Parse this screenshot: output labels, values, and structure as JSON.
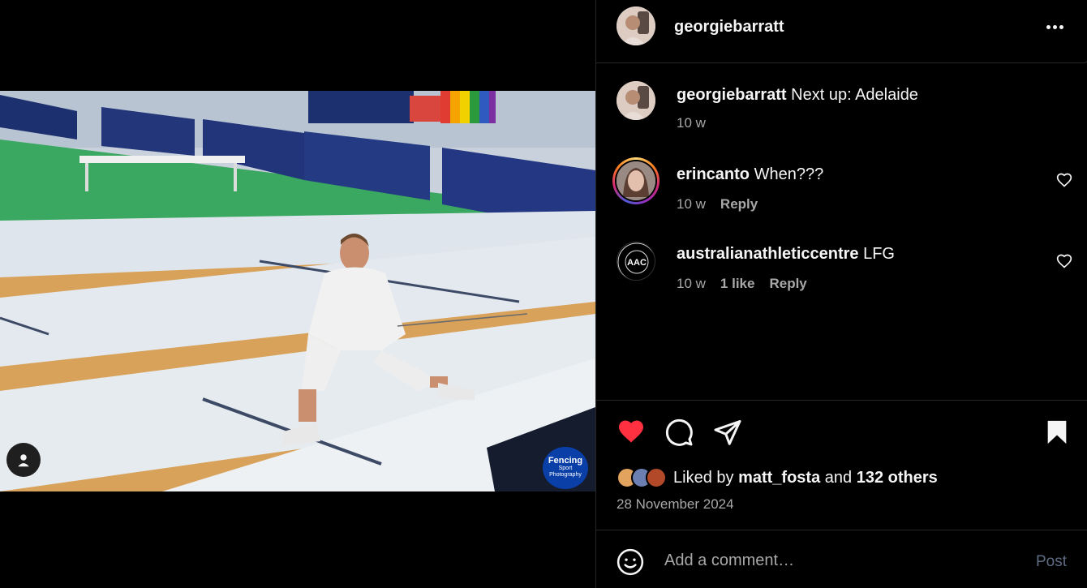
{
  "post": {
    "username": "georgiebarratt",
    "caption_user": "georgiebarratt",
    "caption_text": "Next up: Adelaide",
    "caption_time": "10 w"
  },
  "comments": [
    {
      "user": "erincanto",
      "text": "When???",
      "time": "10 w",
      "reply": "Reply"
    },
    {
      "user": "australianathleticcentre",
      "text": "LFG",
      "time": "10 w",
      "likes": "1 like",
      "reply": "Reply"
    }
  ],
  "likes": {
    "prefix": "Liked by",
    "user": "matt_fosta",
    "middle": "and",
    "others": "132 others"
  },
  "date": "28 November 2024",
  "comment_box": {
    "placeholder": "Add a comment…",
    "post_label": "Post"
  },
  "watermark": {
    "line1": "Fencing",
    "line2": "Sport",
    "line3": "Photography"
  },
  "colors": {
    "like_red": "#ff3040",
    "post_disabled": "#5f6b82",
    "muted": "#a8a8a8"
  },
  "icons": [
    "heart-icon",
    "comment-icon",
    "share-icon",
    "bookmark-icon",
    "more-icon",
    "emoji-icon",
    "user-tag-icon"
  ]
}
